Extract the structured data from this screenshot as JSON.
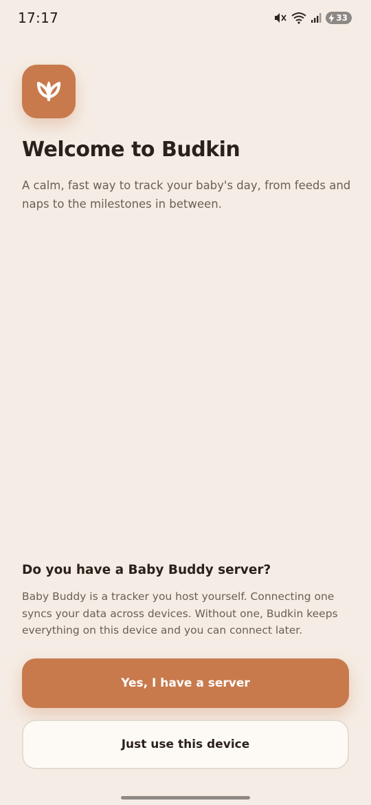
{
  "status_bar": {
    "time": "17:17",
    "battery_level": "33",
    "icons": [
      "mute-vibrate-icon",
      "wifi-icon",
      "cellular-signal-icon",
      "battery-charging-icon"
    ]
  },
  "app": {
    "icon": "sprout-icon"
  },
  "welcome": {
    "title": "Welcome to Budkin",
    "subtitle": "A calm, fast way to track your baby's day, from feeds and naps to the milestones in between."
  },
  "server": {
    "question": "Do you have a Baby Buddy server?",
    "description": "Baby Buddy is a tracker you host yourself. Connecting one syncs your data across devices. Without one, Budkin keeps everything on this device and you can connect later."
  },
  "actions": {
    "primary_label": "Yes, I have a server",
    "secondary_label": "Just use this device"
  },
  "colors": {
    "background": "#f5ede5",
    "accent": "#c87a4d",
    "text_primary": "#2b211b",
    "text_secondary": "#6a5e55",
    "secondary_button_bg": "#fdfaf6"
  }
}
